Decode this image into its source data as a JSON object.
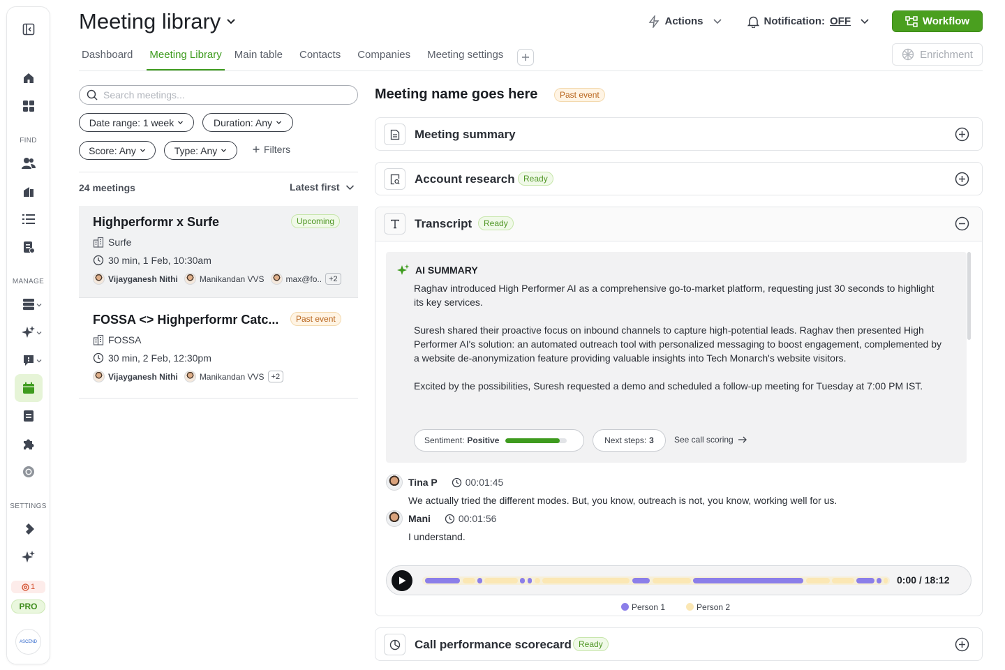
{
  "colors": {
    "accent": "#3e9b1e",
    "workflow_bg": "#4a9f1f",
    "person1": "#8b7ee9",
    "person2": "#fbe7b4",
    "upcoming": "#4f9624",
    "past_event": "#b8641c"
  },
  "sidebar": {
    "sections": {
      "find": "FIND",
      "manage": "MANAGE",
      "settings": "SETTINGS"
    },
    "credits": "1",
    "plan": "PRO",
    "avatar_text": "ASCEND",
    "icons": [
      "collapse-sidebar-icon",
      "home-icon",
      "grid-icon",
      "people-icon",
      "companies-icon",
      "list-icon",
      "document-icon",
      "database-icon",
      "sparkle-icon",
      "chat-icon",
      "calendar-icon",
      "contact-card-icon",
      "puzzle-icon",
      "chrome-icon",
      "diamond-icon",
      "sparkles-settings-icon"
    ]
  },
  "header": {
    "title": "Meeting library",
    "actions_label": "Actions",
    "notification_label": "Notification:",
    "notification_state": "OFF",
    "workflow_label": "Workflow",
    "enrichment_label": "Enrichment"
  },
  "tabs": [
    {
      "label": "Dashboard",
      "active": false
    },
    {
      "label": "Meeting Library",
      "active": true
    },
    {
      "label": "Main table",
      "active": false
    },
    {
      "label": "Contacts",
      "active": false
    },
    {
      "label": "Companies",
      "active": false
    },
    {
      "label": "Meeting settings",
      "active": false
    }
  ],
  "search": {
    "placeholder": "Search meetings..."
  },
  "filters": {
    "date_range": "Date range: 1 week",
    "duration": "Duration: Any",
    "score": "Score: Any",
    "type": "Type: Any",
    "add_filters": "Filters"
  },
  "list": {
    "count": "24 meetings",
    "sort": "Latest first",
    "meetings": [
      {
        "title": "Highperformr x Surfe",
        "badge": "Upcoming",
        "company": "Surfe",
        "when": "30 min, 1 Feb, 10:30am",
        "host": "Vijayganesh Nithi",
        "attendees": [
          "Manikandan VVS",
          "max@fo.."
        ],
        "more": "+2"
      },
      {
        "title": "FOSSA <> Highperformr Catc...",
        "badge": "Past event",
        "company": "FOSSA",
        "when": "30 min, 2 Feb, 12:30pm",
        "host": "Vijayganesh Nithi",
        "attendees": [
          "Manikandan VVS"
        ],
        "more": "+2"
      }
    ]
  },
  "detail": {
    "title": "Meeting name goes here",
    "badge": "Past event",
    "sections": {
      "summary": {
        "title": "Meeting summary"
      },
      "research": {
        "title": "Account research",
        "badge": "Ready"
      },
      "transcript": {
        "title": "Transcript",
        "badge": "Ready"
      },
      "scorecard": {
        "title": "Call performance scorecard",
        "badge": "Ready"
      }
    },
    "ai_summary": {
      "heading": "AI SUMMARY",
      "paragraphs": [
        "Raghav introduced High Performer AI as a comprehensive go-to-market platform, requesting just 30 seconds to highlight its key services.",
        "Suresh shared their proactive focus on inbound channels to capture high-potential leads. Raghav then presented High Performer AI's solution: an automated outreach tool with personalized messaging to boost engagement, complemented by a website de-anonymization feature providing valuable insights into Tech Monarch's website visitors.",
        "Excited by the possibilities, Suresh requested a demo and scheduled a follow-up meeting for Tuesday at 7:00 PM IST."
      ],
      "sentiment_label": "Sentiment:",
      "sentiment_value": "Positive",
      "sentiment_level": 0.88,
      "next_steps_label": "Next steps:",
      "next_steps_value": "3",
      "see_scoring": "See call scoring"
    },
    "utterances": [
      {
        "speaker": "Tina P",
        "time": "00:01:45",
        "text": "We actually tried the different modes. But, you know, outreach is not, you know, working well for us."
      },
      {
        "speaker": "Mani",
        "time": "00:01:56",
        "text": "I understand."
      }
    ],
    "player": {
      "time": "0:00 / 18:12",
      "legend": [
        "Person 1",
        "Person 2"
      ]
    }
  }
}
